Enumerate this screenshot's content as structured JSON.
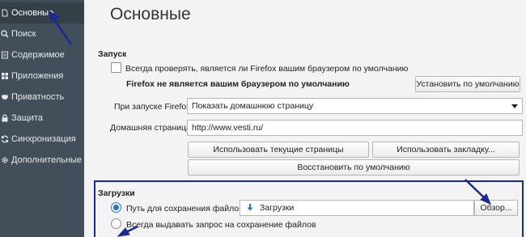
{
  "sidebar": {
    "items": [
      {
        "label": "Основные",
        "icon": "page-icon",
        "active": true
      },
      {
        "label": "Поиск",
        "icon": "search-icon"
      },
      {
        "label": "Содержимое",
        "icon": "page-icon"
      },
      {
        "label": "Приложения",
        "icon": "apps-icon"
      },
      {
        "label": "Приватность",
        "icon": "mask-icon"
      },
      {
        "label": "Защита",
        "icon": "lock-icon"
      },
      {
        "label": "Синхронизация",
        "icon": "sync-icon"
      },
      {
        "label": "Дополнительные",
        "icon": "gear-icon"
      }
    ]
  },
  "main": {
    "title": "Основные",
    "startup": {
      "section_title": "Запуск",
      "default_check_label": "Всегда проверять, является ли Firefox вашим браузером по умолчанию",
      "not_default_text": "Firefox не является вашим браузером по умолчанию",
      "set_default_button": "Установить по умолчанию",
      "on_start_label": "При запуске Firefox:",
      "on_start_value": "Показать домашнюю страницу",
      "homepage_label": "Домашняя страница:",
      "homepage_value": "http://www.vesti.ru/",
      "use_current_button": "Использовать текущие страницы",
      "use_bookmark_button": "Использовать закладку...",
      "restore_default_button": "Восстановить по умолчанию"
    },
    "downloads": {
      "section_title": "Загрузки",
      "save_path_label": "Путь для сохранения файлов",
      "folder_value": "Загрузки",
      "browse_button": "Обзор...",
      "always_ask_label": "Всегда выдавать запрос на сохранение файлов"
    }
  },
  "colors": {
    "sidebar_bg": "#424f5a",
    "sidebar_active": "#343f48",
    "highlight_box": "#1c2a8f",
    "annotation_arrow": "#1c2a8f",
    "radio_accent": "#1a75d1"
  }
}
